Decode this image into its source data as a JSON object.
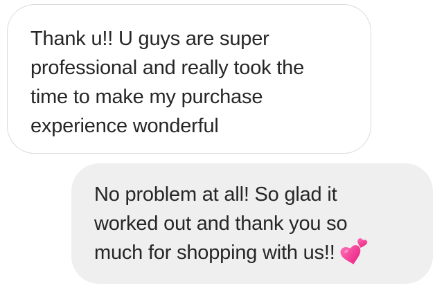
{
  "conversation": {
    "received_message": {
      "lines": [
        "Thank u!! U guys are super",
        "professional and really took the",
        "time to make my purchase",
        "experience wonderful"
      ]
    },
    "sent_message": {
      "lines": [
        "No problem at all! So glad it",
        "worked out and thank you so",
        "much for shopping with us!!"
      ],
      "emoji": "two-hearts-icon"
    }
  },
  "colors": {
    "received_bubble_bg": "#ffffff",
    "received_bubble_border": "#dbdbdb",
    "sent_bubble_bg": "#efefef",
    "text": "#262626",
    "heart": "#ff2d8a"
  }
}
